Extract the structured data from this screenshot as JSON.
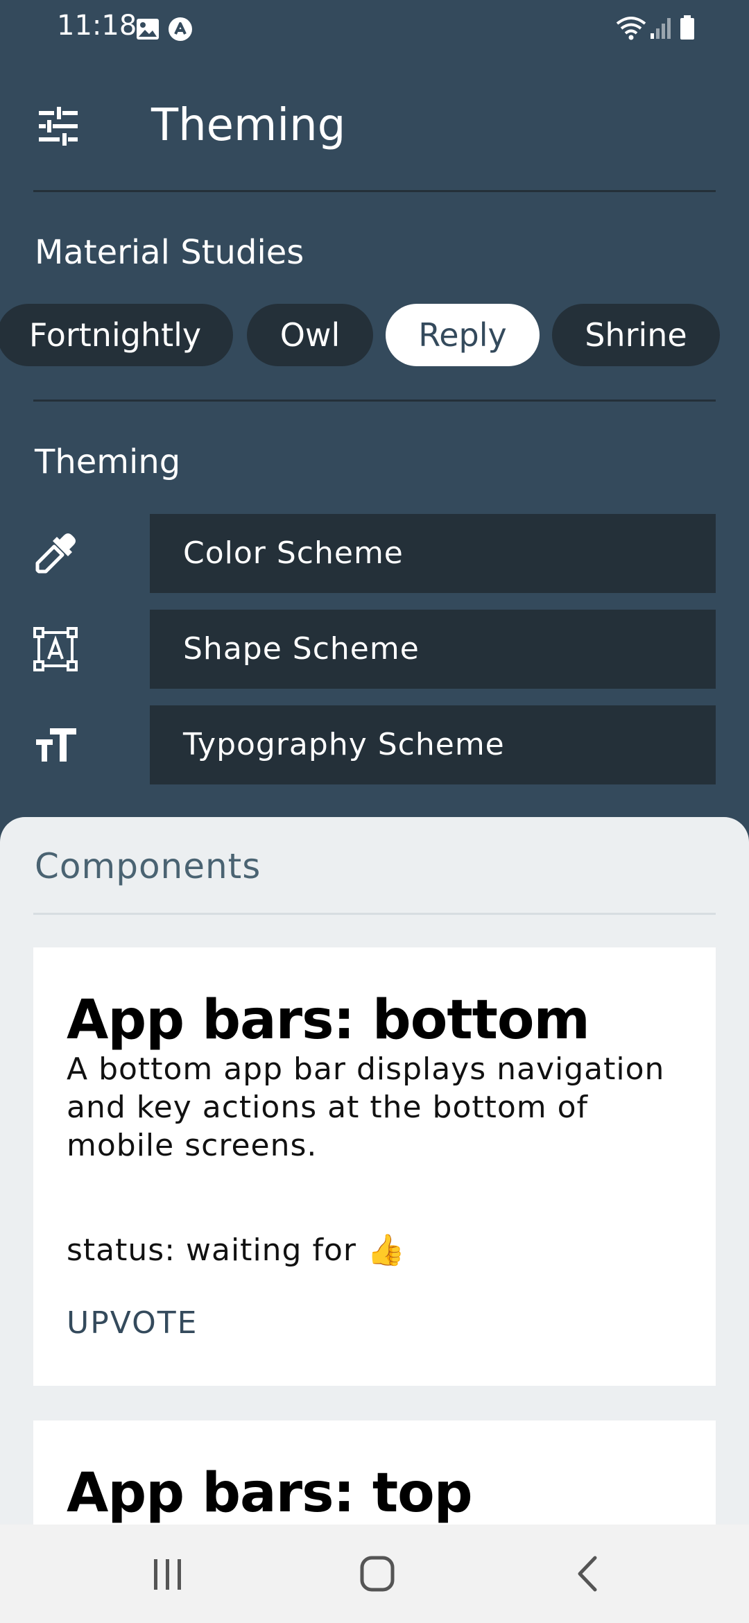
{
  "status_bar": {
    "time": "11:18",
    "icons": [
      "gallery-icon",
      "app-notification-icon",
      "wifi-icon",
      "signal-icon",
      "battery-icon"
    ]
  },
  "app_bar": {
    "title": "Theming",
    "menu_icon": "tune-icon"
  },
  "material_studies": {
    "label": "Material Studies",
    "chips": [
      {
        "label": "Fortnightly",
        "selected": false
      },
      {
        "label": "Owl",
        "selected": false
      },
      {
        "label": "Reply",
        "selected": true
      },
      {
        "label": "Shrine",
        "selected": false
      }
    ]
  },
  "theming": {
    "label": "Theming",
    "items": [
      {
        "label": "Color Scheme",
        "icon": "eyedropper-icon"
      },
      {
        "label": "Shape Scheme",
        "icon": "shape-icon"
      },
      {
        "label": "Typography Scheme",
        "icon": "text-size-icon"
      }
    ]
  },
  "components": {
    "label": "Components",
    "cards": [
      {
        "title": "App bars: bottom",
        "description": "A bottom app bar displays navigation and key actions at the bottom of mobile screens.",
        "status": "status: waiting for 👍",
        "action": "UPVOTE"
      },
      {
        "title": "App bars: top"
      }
    ]
  },
  "nav_bar": {
    "buttons": [
      "recent-apps-icon",
      "home-icon",
      "back-icon"
    ]
  },
  "colors": {
    "primary": "#344a5c",
    "dark": "#243039",
    "surface": "#eceff1",
    "on_primary": "#ffffff"
  }
}
